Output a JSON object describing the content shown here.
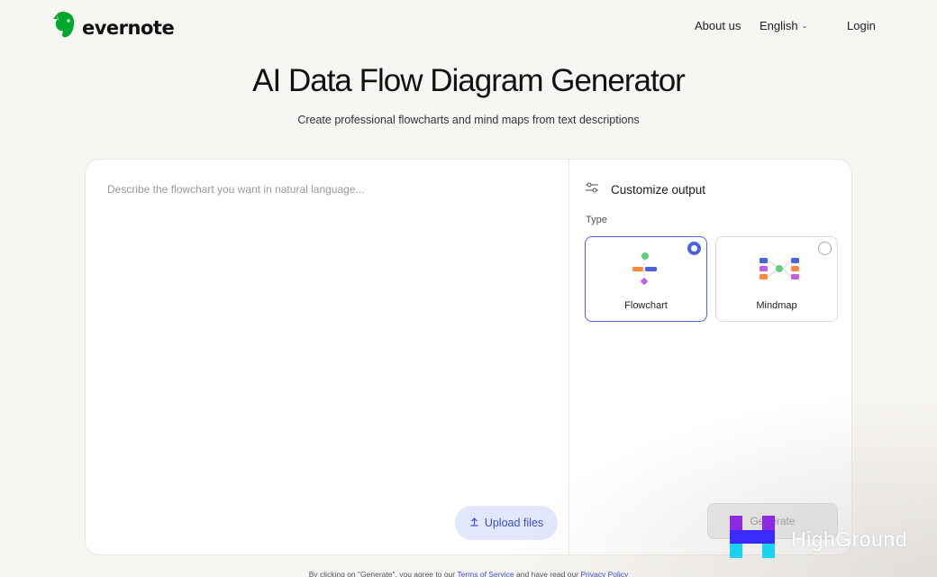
{
  "header": {
    "brand": "evernote",
    "nav": {
      "about": "About us",
      "language": "English",
      "login": "Login"
    }
  },
  "hero": {
    "title": "AI Data Flow Diagram Generator",
    "subtitle": "Create professional flowcharts and mind maps from text descriptions"
  },
  "editor": {
    "placeholder": "Describe the flowchart you want in natural language...",
    "upload_label": "Upload files"
  },
  "customize": {
    "title": "Customize output",
    "type_label": "Type",
    "options": [
      {
        "label": "Flowchart",
        "selected": true
      },
      {
        "label": "Mindmap",
        "selected": false
      }
    ],
    "generate_label": "Generate"
  },
  "footer": {
    "prefix": "By clicking on \"Generate\", you agree to our",
    "terms": "Terms of Service",
    "middle": "and have read our",
    "privacy": "Privacy Policy"
  },
  "watermark": {
    "text": "HighGround"
  },
  "colors": {
    "brand_green": "#00a82d",
    "accent_blue": "#4a63e0",
    "upload_bg": "#e3e7fb",
    "page_bg": "#f8f6f2"
  }
}
